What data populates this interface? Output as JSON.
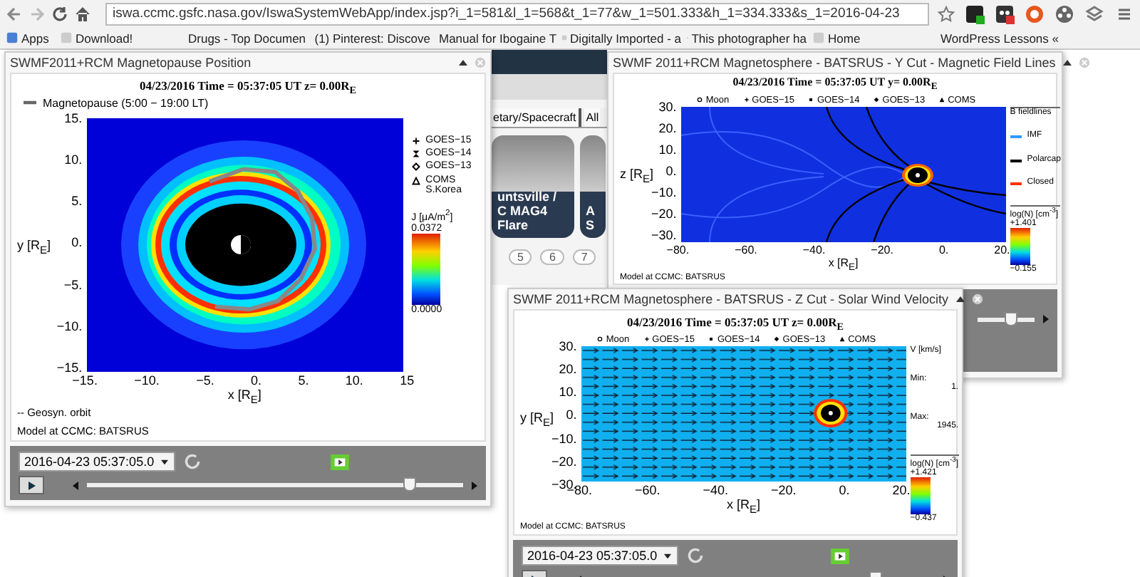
{
  "browser": {
    "url": "iswa.ccmc.gsfc.nasa.gov/IswaSystemWebApp/index.jsp?i_1=581&l_1=568&t_1=77&w_1=501.333&h_1=334.333&s_1=2016-04-23",
    "bookmarks": [
      "Apps",
      "Download!",
      "Drugs - Top Documen",
      "(1) Pinterest: Discove",
      "Manual for Ibogaine T",
      "Digitally Imported - a",
      "This photographer ha",
      "Home",
      "WordPress Lessons «"
    ]
  },
  "background": {
    "tabs": [
      "etary/Spacecraft",
      "All"
    ],
    "thumbnails": [
      {
        "caption": "untsville /\nC MAG4\nFlare"
      },
      {
        "caption": "A\nS"
      }
    ],
    "pages": [
      "5",
      "6",
      "7"
    ]
  },
  "windows": [
    {
      "kind": "magnetopause",
      "title": "SWMF2011+RCM Magnetopause Position",
      "plot_title": "04/23/2016 Time = 05:37:05 UT z= 0.00R$_{E}$",
      "top_legend": [
        {
          "kind": "line",
          "label": "Magnetopause (5:00 − 19:00 LT)"
        }
      ],
      "yticks": [
        "15.",
        "10.",
        "5.",
        "0.",
        "−5.",
        "−10.",
        "−15."
      ],
      "ylabel": "y [R$_{E}$]",
      "xticks": [
        "−15.",
        "−10.",
        "−5.",
        "0.",
        "5.",
        "10.",
        "15"
      ],
      "xlabel": "x [R$_{E}$]",
      "side_legend": [
        {
          "kind": "plus",
          "label": "GOES−15"
        },
        {
          "kind": "star",
          "label": "GOES−14"
        },
        {
          "kind": "diamond",
          "label": "GOES−13"
        },
        {
          "kind": "triangle",
          "label": "COMS\nS.Korea"
        }
      ],
      "colorbar": {
        "label": "J [μA/m$^{2}$]",
        "max": "0.0372",
        "min": "0.0000"
      },
      "notes": [
        "-- Geosyn. orbit",
        "Model at CCMC: BATSRUS"
      ],
      "time": "2016-04-23 05:37:05.0",
      "level": 0.86
    },
    {
      "kind": "field-lines",
      "title": "SWMF 2011+RCM Magnetosphere - BATSRUS - Y Cut - Magnetic Field Lines",
      "plot_title": "04/23/2016 Time = 05:37:05 UT y= 0.00R$_{E}$",
      "top_legend": [
        {
          "kind": "circle",
          "label": "Moon"
        },
        {
          "kind": "plus",
          "label": "GOES−15"
        },
        {
          "kind": "square",
          "label": "GOES−14"
        },
        {
          "kind": "diamond",
          "label": "GOES−13"
        },
        {
          "kind": "triangle",
          "label": "COMS"
        }
      ],
      "yticks": [
        "30.",
        "20.",
        "10.",
        "0.",
        "−10.",
        "−20.",
        "−30."
      ],
      "ylabel": "z [R$_{E}$]",
      "xticks": [
        "−80.",
        "−60.",
        "−40.",
        "−20.",
        "0.",
        "20."
      ],
      "xlabel": "x [R$_{E}$]",
      "side_title": "B fieldlines",
      "side_legend": [
        {
          "label": "IMF",
          "color": "#3399ff"
        },
        {
          "label": "Polarcap",
          "color": "#000000"
        },
        {
          "label": "Closed",
          "color": "#ff3300"
        }
      ],
      "colorbar": {
        "label": "log(N) [cm$^{-3}$]",
        "max": "+1.401",
        "min": "−0.155"
      },
      "notes": [
        "Model at CCMC: BATSRUS"
      ],
      "level": 0.6
    },
    {
      "kind": "velocity",
      "title": "SWMF 2011+RCM Magnetosphere - BATSRUS - Z Cut - Solar Wind Velocity",
      "plot_title": "04/23/2016 Time = 05:37:05 UT z= 0.00R$_{E}$",
      "top_legend": [
        {
          "kind": "circle",
          "label": "Moon"
        },
        {
          "kind": "plus",
          "label": "GOES−15"
        },
        {
          "kind": "square",
          "label": "GOES−14"
        },
        {
          "kind": "diamond",
          "label": "GOES−13"
        },
        {
          "kind": "triangle",
          "label": "COMS"
        }
      ],
      "yticks": [
        "30.",
        "20.",
        "10.",
        "0.",
        "−10.",
        "−20.",
        "−30."
      ],
      "ylabel": "y [R$_{E}$]",
      "xticks": [
        "−80.",
        "−60.",
        "−40.",
        "−20.",
        "0.",
        "20."
      ],
      "xlabel": "x [R$_{E}$]",
      "side_title": "V [km/s]",
      "side_stats": [
        {
          "label": "Min:",
          "value": "1."
        },
        {
          "label": "Max:",
          "value": "1945."
        }
      ],
      "colorbar": {
        "label": "log(N) [cm$^{-3}$]",
        "max": "+1.421",
        "min": "−0.437"
      },
      "notes": [
        "Model at CCMC: BATSRUS"
      ],
      "time": "2016-04-23 05:37:05.0",
      "level": 0.83
    }
  ]
}
